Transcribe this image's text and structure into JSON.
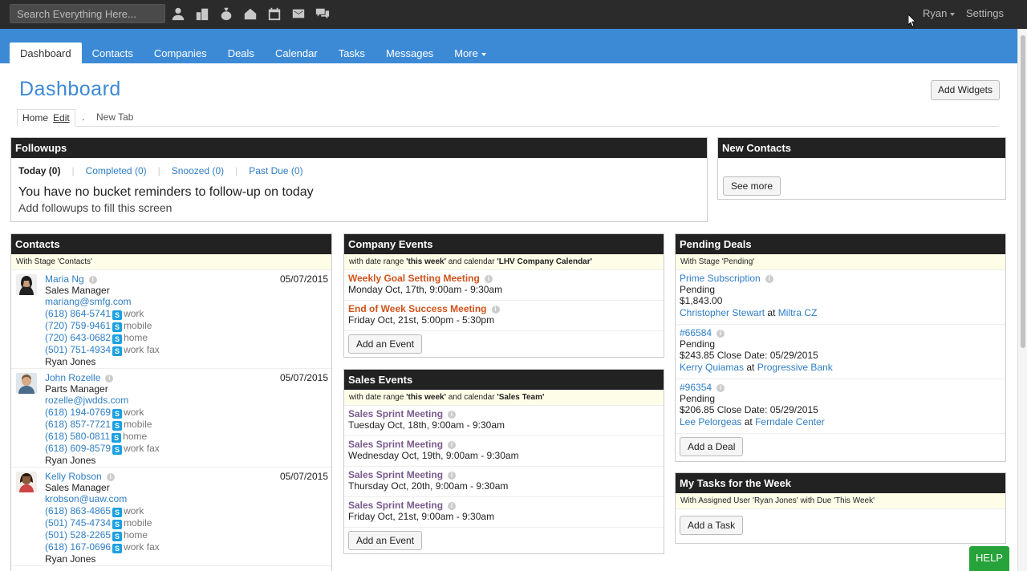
{
  "topbar": {
    "search_placeholder": "Search Everything Here...",
    "icons": [
      "contacts-icon",
      "companies-icon",
      "deals-icon",
      "inbox-icon",
      "calendar-icon",
      "mail-icon",
      "chat-icon"
    ],
    "user": "Ryan",
    "settings": "Settings"
  },
  "nav": {
    "tabs": [
      "Dashboard",
      "Contacts",
      "Companies",
      "Deals",
      "Calendar",
      "Tasks",
      "Messages",
      "More"
    ],
    "active": "Dashboard"
  },
  "page": {
    "title": "Dashboard",
    "add_widgets": "Add Widgets",
    "subtabs": {
      "home": "Home",
      "edit": "Edit",
      "dot": ".",
      "new_tab": "New Tab"
    }
  },
  "followups": {
    "title": "Followups",
    "tabs": [
      "Today (0)",
      "Completed (0)",
      "Snoozed (0)",
      "Past Due (0)"
    ],
    "message": "You have no bucket reminders to follow-up on today",
    "hint": "Add followups to fill this screen"
  },
  "new_contacts": {
    "title": "New Contacts",
    "button": "See more"
  },
  "contacts": {
    "title": "Contacts",
    "stage_note": "With Stage 'Contacts'",
    "items": [
      {
        "name": "Maria Ng",
        "role": "Sales Manager",
        "email": "mariang@smfg.com",
        "date": "05/07/2015",
        "phones": [
          {
            "num": "(618) 864-5741",
            "type": "work"
          },
          {
            "num": "(720) 759-9461",
            "type": "mobile"
          },
          {
            "num": "(720) 643-0682",
            "type": "home"
          },
          {
            "num": "(501) 751-4934",
            "type": "work fax"
          }
        ],
        "owner": "Ryan Jones"
      },
      {
        "name": "John Rozelle",
        "role": "Parts Manager",
        "email": "rozelle@jwdds.com",
        "date": "05/07/2015",
        "phones": [
          {
            "num": "(618) 194-0769",
            "type": "work"
          },
          {
            "num": "(618) 857-7721",
            "type": "mobile"
          },
          {
            "num": "(618) 580-0811",
            "type": "home"
          },
          {
            "num": "(618) 609-8579",
            "type": "work fax"
          }
        ],
        "owner": "Ryan Jones"
      },
      {
        "name": "Kelly Robson",
        "role": "Sales Manager",
        "email": "krobson@uaw.com",
        "date": "05/07/2015",
        "phones": [
          {
            "num": "(618) 863-4865",
            "type": "work"
          },
          {
            "num": "(501) 745-4734",
            "type": "mobile"
          },
          {
            "num": "(501) 528-2265",
            "type": "home"
          },
          {
            "num": "(618) 167-0696",
            "type": "work fax"
          }
        ],
        "owner": "Ryan Jones"
      }
    ]
  },
  "company_events": {
    "title": "Company Events",
    "note_prefix": "with date range ",
    "note_range": "'this week'",
    "note_mid": " and calendar ",
    "note_calendar": "'LHV Company Calendar'",
    "events": [
      {
        "title": "Weekly Goal Setting Meeting",
        "when": "Monday Oct, 17th, 9:00am - 9:30am"
      },
      {
        "title": "End of Week Success Meeting",
        "when": "Friday Oct, 21st, 5:00pm - 5:30pm"
      }
    ],
    "button": "Add an Event"
  },
  "sales_events": {
    "title": "Sales Events",
    "note_prefix": "with date range ",
    "note_range": "'this week'",
    "note_mid": " and calendar ",
    "note_calendar": "'Sales Team'",
    "events": [
      {
        "title": "Sales Sprint Meeting",
        "when": "Tuesday Oct, 18th, 9:00am - 9:30am"
      },
      {
        "title": "Sales Sprint Meeting",
        "when": "Wednesday Oct, 19th, 9:00am - 9:30am"
      },
      {
        "title": "Sales Sprint Meeting",
        "when": "Thursday Oct, 20th, 9:00am - 9:30am"
      },
      {
        "title": "Sales Sprint Meeting",
        "when": "Friday Oct, 21st, 9:00am - 9:30am"
      }
    ],
    "button": "Add an Event"
  },
  "pending_deals": {
    "title": "Pending Deals",
    "stage_note": "With Stage 'Pending'",
    "deals": [
      {
        "name": "Prime Subscription",
        "status": "Pending",
        "amount": "$1,843.00",
        "contact": "Christopher Stewart",
        "at": "at",
        "company": "Miltra CZ"
      },
      {
        "name": "#66584",
        "status": "Pending",
        "amount": "$243.85 Close Date: 05/29/2015",
        "contact": "Kerry Quiamas",
        "at": "at",
        "company": "Progressive Bank"
      },
      {
        "name": "#96354",
        "status": "Pending",
        "amount": "$206.85 Close Date: 05/29/2015",
        "contact": "Lee Pelorgeas",
        "at": "at",
        "company": "Ferndale Center"
      }
    ],
    "button": "Add a Deal"
  },
  "tasks": {
    "title": "My Tasks for the Week",
    "note": "With Assigned User 'Ryan Jones' with Due 'This Week'",
    "button": "Add a Task"
  },
  "help": "HELP",
  "colors": {
    "nav": "#3c8ad6",
    "topbar": "#2b2b2b",
    "panel_head": "#222222",
    "link": "#2f7ec4",
    "help": "#26a33a"
  }
}
